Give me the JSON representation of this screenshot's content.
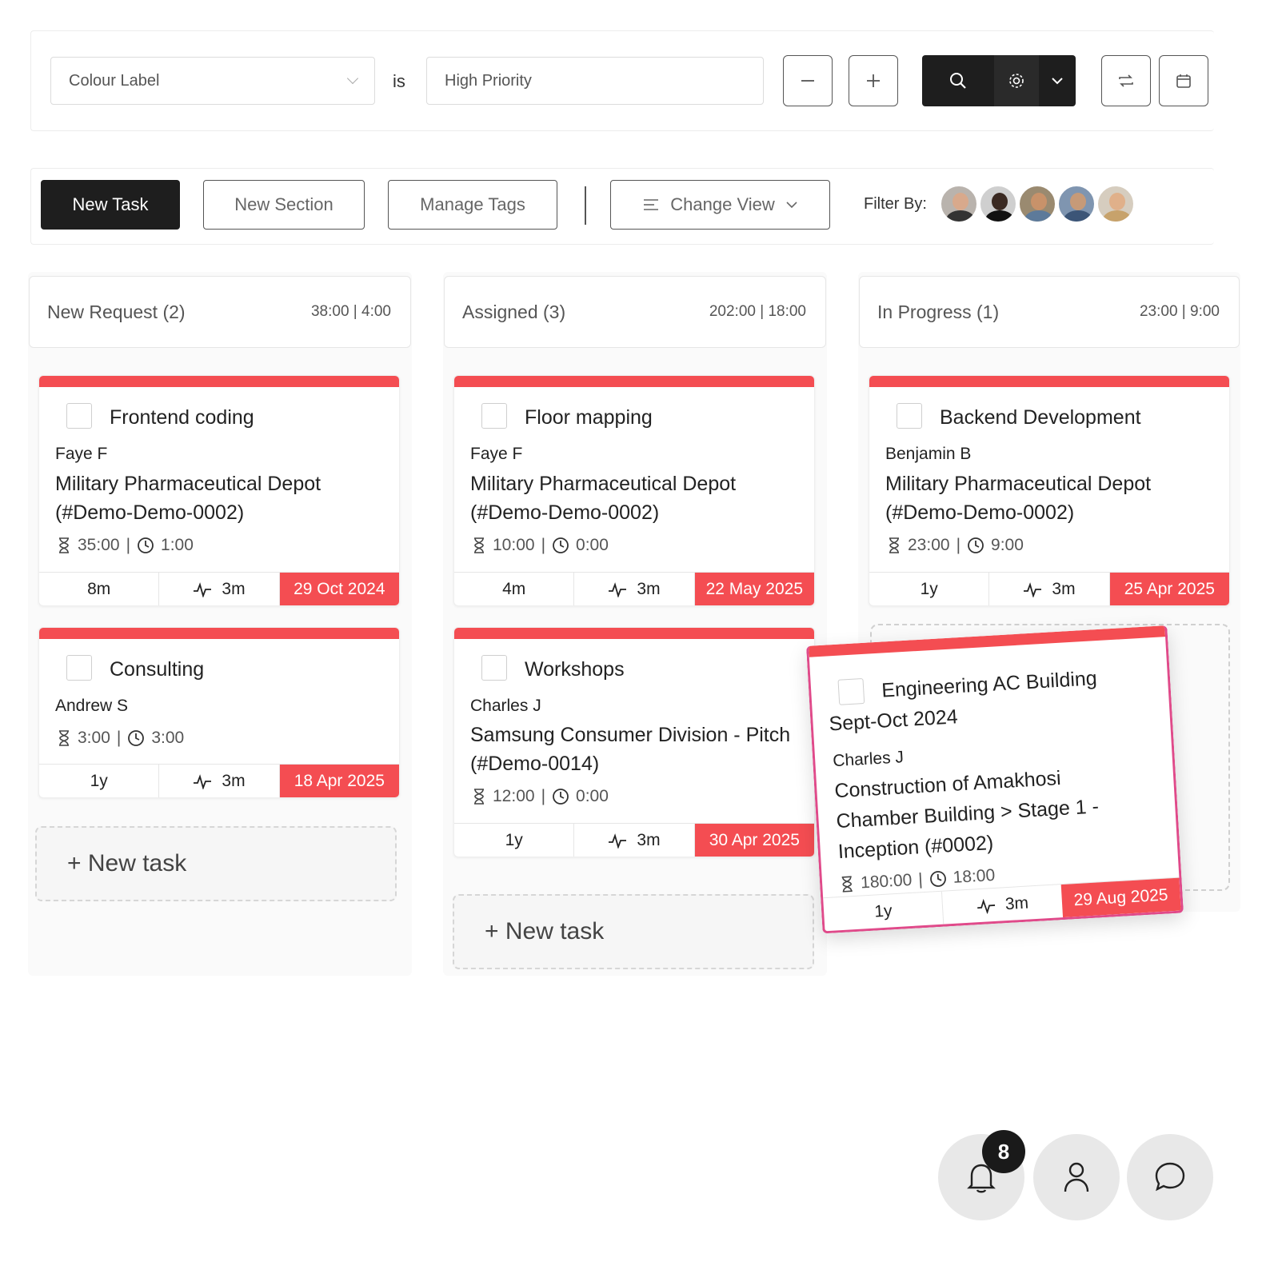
{
  "filter": {
    "field_value": "Colour Label",
    "operator": "is",
    "value": "High Priority"
  },
  "toolbar": {
    "new_task_label": "New Task",
    "new_section_label": "New Section",
    "manage_tags_label": "Manage Tags",
    "change_view_label": "Change View",
    "filter_by_label": "Filter By:"
  },
  "columns": [
    {
      "title": "New Request (2)",
      "times": "38:00 | 4:00",
      "cards": [
        {
          "title": "Frontend coding",
          "person": "Faye F",
          "project": "Military Pharmaceutical Depot (#Demo-Demo-0002)",
          "estimate": "35:00",
          "logged": "1:00",
          "age": "8m",
          "activity": "3m",
          "due": "29 Oct 2024"
        },
        {
          "title": "Consulting",
          "person": "Andrew S",
          "project": "",
          "estimate": "3:00",
          "logged": "3:00",
          "age": "1y",
          "activity": "3m",
          "due": "18 Apr 2025"
        }
      ],
      "new_task_label": "+ New task"
    },
    {
      "title": "Assigned (3)",
      "times": "202:00 | 18:00",
      "cards": [
        {
          "title": "Floor mapping",
          "person": "Faye F",
          "project": "Military Pharmaceutical Depot (#Demo-Demo-0002)",
          "estimate": "10:00",
          "logged": "0:00",
          "age": "4m",
          "activity": "3m",
          "due": "22 May 2025"
        },
        {
          "title": "Workshops",
          "person": "Charles J",
          "project": "Samsung Consumer Division - Pitch (#Demo-0014)",
          "estimate": "12:00",
          "logged": "0:00",
          "age": "1y",
          "activity": "3m",
          "due": "30 Apr 2025"
        }
      ],
      "new_task_label": "+ New task"
    },
    {
      "title": "In Progress (1)",
      "times": "23:00 | 9:00",
      "cards": [
        {
          "title": "Backend Development",
          "person": "Benjamin B",
          "project": "Military Pharmaceutical Depot (#Demo-Demo-0002)",
          "estimate": "23:00",
          "logged": "9:00",
          "age": "1y",
          "activity": "3m",
          "due": "25 Apr 2025"
        }
      ]
    }
  ],
  "dragged_card": {
    "title": "Engineering AC Building Sept-Oct 2024",
    "person": "Charles J",
    "project": "Construction of Amakhosi Chamber Building > Stage 1 - Inception (#0002)",
    "estimate": "180:00",
    "logged": "18:00",
    "age": "1y",
    "activity": "3m",
    "due": "29 Aug 2025"
  },
  "notifications": {
    "count": "8"
  },
  "colors": {
    "accent_red": "#f44d52",
    "dark": "#1e1e1e",
    "drag_border": "#e04a8a"
  }
}
